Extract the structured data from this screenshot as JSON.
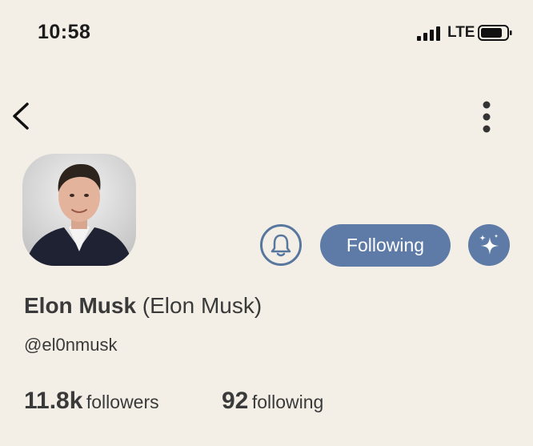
{
  "status_bar": {
    "time": "10:58",
    "network": "LTE",
    "icons": [
      "signal-icon",
      "battery-icon"
    ]
  },
  "nav": {
    "back_icon": "chevron-left-icon",
    "more_icon": "more-vertical-icon"
  },
  "profile": {
    "display_name": "Elon Musk",
    "real_name": "(Elon Musk)",
    "handle": "@el0nmusk",
    "avatar_icon": "profile-photo"
  },
  "actions": {
    "notify_icon": "bell-icon",
    "follow_label": "Following",
    "sparkle_icon": "sparkle-icon"
  },
  "stats": {
    "followers_count": "11.8k",
    "followers_label": "followers",
    "following_count": "92",
    "following_label": "following"
  },
  "colors": {
    "background": "#f3efe6",
    "accent": "#5d7ba6",
    "text": "#3a3a3a"
  }
}
